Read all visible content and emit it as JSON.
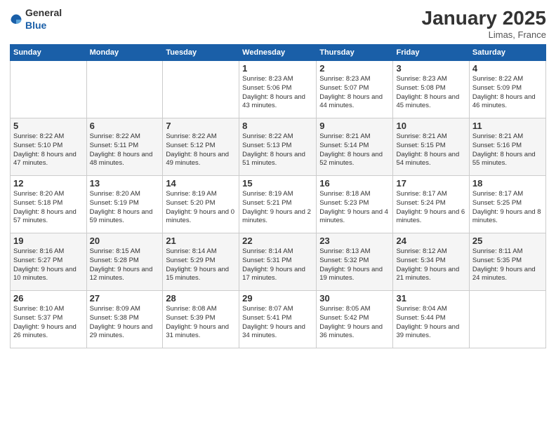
{
  "header": {
    "logo_general": "General",
    "logo_blue": "Blue",
    "title": "January 2025",
    "location": "Limas, France"
  },
  "days_of_week": [
    "Sunday",
    "Monday",
    "Tuesday",
    "Wednesday",
    "Thursday",
    "Friday",
    "Saturday"
  ],
  "weeks": [
    [
      {
        "day": "",
        "sunrise": "",
        "sunset": "",
        "daylight": ""
      },
      {
        "day": "",
        "sunrise": "",
        "sunset": "",
        "daylight": ""
      },
      {
        "day": "",
        "sunrise": "",
        "sunset": "",
        "daylight": ""
      },
      {
        "day": "1",
        "sunrise": "Sunrise: 8:23 AM",
        "sunset": "Sunset: 5:06 PM",
        "daylight": "Daylight: 8 hours and 43 minutes."
      },
      {
        "day": "2",
        "sunrise": "Sunrise: 8:23 AM",
        "sunset": "Sunset: 5:07 PM",
        "daylight": "Daylight: 8 hours and 44 minutes."
      },
      {
        "day": "3",
        "sunrise": "Sunrise: 8:23 AM",
        "sunset": "Sunset: 5:08 PM",
        "daylight": "Daylight: 8 hours and 45 minutes."
      },
      {
        "day": "4",
        "sunrise": "Sunrise: 8:22 AM",
        "sunset": "Sunset: 5:09 PM",
        "daylight": "Daylight: 8 hours and 46 minutes."
      }
    ],
    [
      {
        "day": "5",
        "sunrise": "Sunrise: 8:22 AM",
        "sunset": "Sunset: 5:10 PM",
        "daylight": "Daylight: 8 hours and 47 minutes."
      },
      {
        "day": "6",
        "sunrise": "Sunrise: 8:22 AM",
        "sunset": "Sunset: 5:11 PM",
        "daylight": "Daylight: 8 hours and 48 minutes."
      },
      {
        "day": "7",
        "sunrise": "Sunrise: 8:22 AM",
        "sunset": "Sunset: 5:12 PM",
        "daylight": "Daylight: 8 hours and 49 minutes."
      },
      {
        "day": "8",
        "sunrise": "Sunrise: 8:22 AM",
        "sunset": "Sunset: 5:13 PM",
        "daylight": "Daylight: 8 hours and 51 minutes."
      },
      {
        "day": "9",
        "sunrise": "Sunrise: 8:21 AM",
        "sunset": "Sunset: 5:14 PM",
        "daylight": "Daylight: 8 hours and 52 minutes."
      },
      {
        "day": "10",
        "sunrise": "Sunrise: 8:21 AM",
        "sunset": "Sunset: 5:15 PM",
        "daylight": "Daylight: 8 hours and 54 minutes."
      },
      {
        "day": "11",
        "sunrise": "Sunrise: 8:21 AM",
        "sunset": "Sunset: 5:16 PM",
        "daylight": "Daylight: 8 hours and 55 minutes."
      }
    ],
    [
      {
        "day": "12",
        "sunrise": "Sunrise: 8:20 AM",
        "sunset": "Sunset: 5:18 PM",
        "daylight": "Daylight: 8 hours and 57 minutes."
      },
      {
        "day": "13",
        "sunrise": "Sunrise: 8:20 AM",
        "sunset": "Sunset: 5:19 PM",
        "daylight": "Daylight: 8 hours and 59 minutes."
      },
      {
        "day": "14",
        "sunrise": "Sunrise: 8:19 AM",
        "sunset": "Sunset: 5:20 PM",
        "daylight": "Daylight: 9 hours and 0 minutes."
      },
      {
        "day": "15",
        "sunrise": "Sunrise: 8:19 AM",
        "sunset": "Sunset: 5:21 PM",
        "daylight": "Daylight: 9 hours and 2 minutes."
      },
      {
        "day": "16",
        "sunrise": "Sunrise: 8:18 AM",
        "sunset": "Sunset: 5:23 PM",
        "daylight": "Daylight: 9 hours and 4 minutes."
      },
      {
        "day": "17",
        "sunrise": "Sunrise: 8:17 AM",
        "sunset": "Sunset: 5:24 PM",
        "daylight": "Daylight: 9 hours and 6 minutes."
      },
      {
        "day": "18",
        "sunrise": "Sunrise: 8:17 AM",
        "sunset": "Sunset: 5:25 PM",
        "daylight": "Daylight: 9 hours and 8 minutes."
      }
    ],
    [
      {
        "day": "19",
        "sunrise": "Sunrise: 8:16 AM",
        "sunset": "Sunset: 5:27 PM",
        "daylight": "Daylight: 9 hours and 10 minutes."
      },
      {
        "day": "20",
        "sunrise": "Sunrise: 8:15 AM",
        "sunset": "Sunset: 5:28 PM",
        "daylight": "Daylight: 9 hours and 12 minutes."
      },
      {
        "day": "21",
        "sunrise": "Sunrise: 8:14 AM",
        "sunset": "Sunset: 5:29 PM",
        "daylight": "Daylight: 9 hours and 15 minutes."
      },
      {
        "day": "22",
        "sunrise": "Sunrise: 8:14 AM",
        "sunset": "Sunset: 5:31 PM",
        "daylight": "Daylight: 9 hours and 17 minutes."
      },
      {
        "day": "23",
        "sunrise": "Sunrise: 8:13 AM",
        "sunset": "Sunset: 5:32 PM",
        "daylight": "Daylight: 9 hours and 19 minutes."
      },
      {
        "day": "24",
        "sunrise": "Sunrise: 8:12 AM",
        "sunset": "Sunset: 5:34 PM",
        "daylight": "Daylight: 9 hours and 21 minutes."
      },
      {
        "day": "25",
        "sunrise": "Sunrise: 8:11 AM",
        "sunset": "Sunset: 5:35 PM",
        "daylight": "Daylight: 9 hours and 24 minutes."
      }
    ],
    [
      {
        "day": "26",
        "sunrise": "Sunrise: 8:10 AM",
        "sunset": "Sunset: 5:37 PM",
        "daylight": "Daylight: 9 hours and 26 minutes."
      },
      {
        "day": "27",
        "sunrise": "Sunrise: 8:09 AM",
        "sunset": "Sunset: 5:38 PM",
        "daylight": "Daylight: 9 hours and 29 minutes."
      },
      {
        "day": "28",
        "sunrise": "Sunrise: 8:08 AM",
        "sunset": "Sunset: 5:39 PM",
        "daylight": "Daylight: 9 hours and 31 minutes."
      },
      {
        "day": "29",
        "sunrise": "Sunrise: 8:07 AM",
        "sunset": "Sunset: 5:41 PM",
        "daylight": "Daylight: 9 hours and 34 minutes."
      },
      {
        "day": "30",
        "sunrise": "Sunrise: 8:05 AM",
        "sunset": "Sunset: 5:42 PM",
        "daylight": "Daylight: 9 hours and 36 minutes."
      },
      {
        "day": "31",
        "sunrise": "Sunrise: 8:04 AM",
        "sunset": "Sunset: 5:44 PM",
        "daylight": "Daylight: 9 hours and 39 minutes."
      },
      {
        "day": "",
        "sunrise": "",
        "sunset": "",
        "daylight": ""
      }
    ]
  ]
}
